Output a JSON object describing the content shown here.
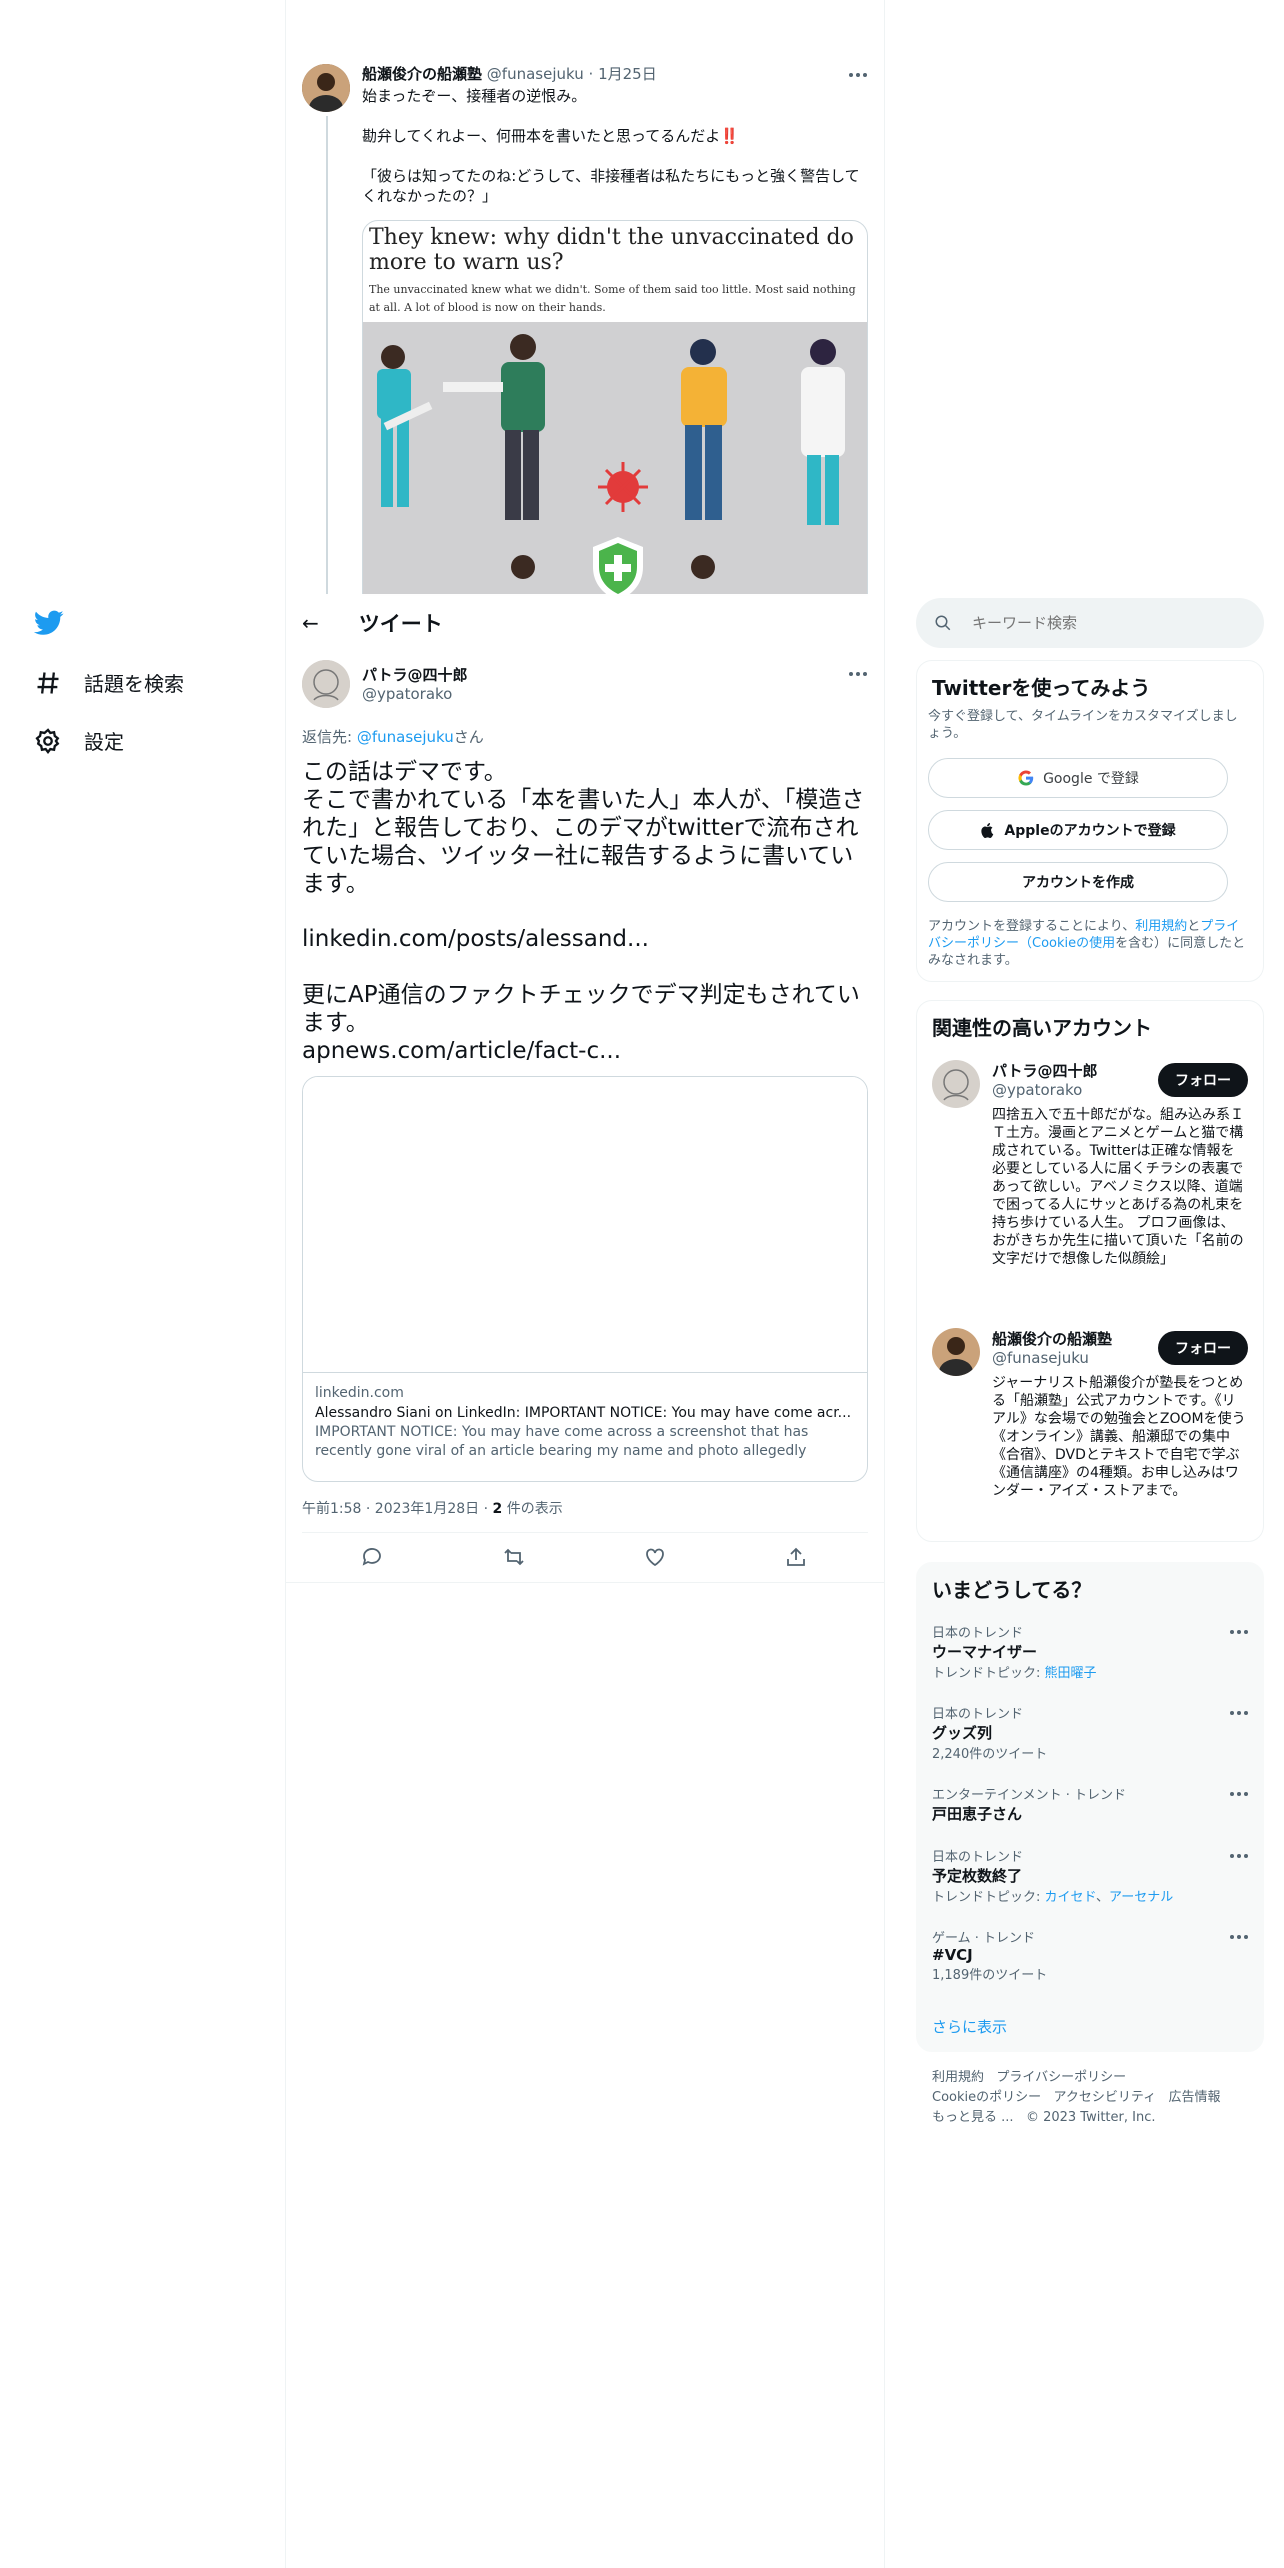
{
  "nav": {
    "items": [
      {
        "label": "話題を検索",
        "icon": "hashtag-icon"
      },
      {
        "label": "設定",
        "icon": "gear-icon"
      }
    ]
  },
  "parent_tweet": {
    "author_name": "船瀬俊介の船瀬塾",
    "handle": "@funasejuku",
    "separator": "·",
    "date": "1月25日",
    "line1": "始まったぞー、接種者の逆恨み。",
    "line2": "勘弁してくれよー、何冊本を書いたと思ってるんだよ",
    "line2_emoji": "‼️",
    "line3": "「彼らは知ってたのね:どうして、非接種者は私たちにもっと強く警告してくれなかったの？」",
    "image_headline": "They knew: why didn't the unvaccinated do more to warn us?",
    "image_subhead": "The unvaccinated knew what we didn't. Some of them said too little. Most said nothing at all. A lot of blood is now on their hands."
  },
  "header": {
    "back": "←",
    "title": "ツイート"
  },
  "reply": {
    "author_name": "パトラ@四十郎",
    "handle": "@ypatorako",
    "reply_to_prefix": "返信先: ",
    "reply_to_handle": "@funasejuku",
    "reply_to_suffix": "さん",
    "text_p1": "この話はデマです。\nそこで書かれている「本を書いた人」本人が、「模造された」と報告しており、このデマがtwitterで流布されていた場合、ツイッター社に報告するように書いています。",
    "link1": "linkedin.com/posts/alessand...",
    "text_p2": "更にAP通信のファクトチェックでデマ判定もされています。",
    "link2": "apnews.com/article/fact-c...",
    "card": {
      "domain": "linkedin.com",
      "title": "Alessandro Siani on LinkedIn: IMPORTANT NOTICE: You may have come acr...",
      "description": "IMPORTANT NOTICE: You may have come across a screenshot that has recently gone viral of an article bearing my name and photo allegedly published ..."
    },
    "timestamp": "午前1:58 · 2023年1月28日 · ",
    "views_count": "2",
    "views_label": " 件の表示"
  },
  "search": {
    "placeholder": "キーワード検索"
  },
  "signup": {
    "title": "Twitterを使ってみよう",
    "subtitle": "今すぐ登録して、タイムラインをカスタマイズしましょう。",
    "google_button": "Google で登録",
    "apple_button": "Appleのアカウントで登録",
    "create_button": "アカウントを作成",
    "legal_prefix": "アカウントを登録することにより、",
    "legal_terms": "利用規約",
    "legal_and": "と",
    "legal_privacy": "プライバシーポリシー（Cookieの使用",
    "legal_suffix": "を含む）に同意したとみなされます。"
  },
  "related": {
    "title": "関連性の高いアカウント",
    "accounts": [
      {
        "name": "パトラ@四十郎",
        "handle": "@ypatorako",
        "follow": "フォロー",
        "bio": "四捨五入で五十郎だがな。組み込み系ＩＴ土方。漫画とアニメとゲームと猫で構成されている。Twitterは正確な情報を必要としている人に届くチラシの表裏であって欲しい。アベノミクス以降、道端で困ってる人にサッとあげる為の札束を持ち歩けている人生。 プロフ画像は、おがきちか先生に描いて頂いた「名前の文字だけで想像した似顔絵」"
      },
      {
        "name": "船瀬俊介の船瀬塾",
        "handle": "@funasejuku",
        "follow": "フォロー",
        "bio": "ジャーナリスト船瀬俊介が塾長をつとめる「船瀬塾」公式アカウントです。《リアル》な会場での勉強会とZOOMを使う《オンライン》講義、船瀬邸での集中《合宿》、DVDとテキストで自宅で学ぶ《通信講座》の4種類。お申し込みはワンダー・アイズ・ストアまで。"
      }
    ]
  },
  "trends": {
    "title": "いまどうしてる？",
    "items": [
      {
        "category": "日本のトレンド",
        "name": "ウーマナイザー",
        "meta_prefix": "トレンドトピック: ",
        "meta_links": [
          "熊田曜子"
        ],
        "meta_plain": ""
      },
      {
        "category": "日本のトレンド",
        "name": "グッズ列",
        "meta_prefix": "",
        "meta_links": [],
        "meta_plain": "2,240件のツイート"
      },
      {
        "category": "エンターテインメント · トレンド",
        "name": "戸田恵子さん",
        "meta_prefix": "",
        "meta_links": [],
        "meta_plain": ""
      },
      {
        "category": "日本のトレンド",
        "name": "予定枚数終了",
        "meta_prefix": "トレンドトピック: ",
        "meta_links": [
          "カイセド",
          "アーセナル"
        ],
        "meta_plain": ""
      },
      {
        "category": "ゲーム · トレンド",
        "name": "#VCJ",
        "meta_prefix": "",
        "meta_links": [],
        "meta_plain": "1,189件のツイート"
      }
    ],
    "show_more": "さらに表示"
  },
  "footer": {
    "line1": [
      "利用規約",
      "プライバシーポリシー"
    ],
    "line2": [
      "Cookieのポリシー",
      "アクセシビリティ",
      "広告情報"
    ],
    "line3": [
      "もっと見る ...",
      "© 2023 Twitter, Inc."
    ]
  },
  "colors": {
    "accent": "#1d9bf0",
    "text": "#0f1419",
    "muted": "#536471",
    "border": "#eff3f4"
  }
}
